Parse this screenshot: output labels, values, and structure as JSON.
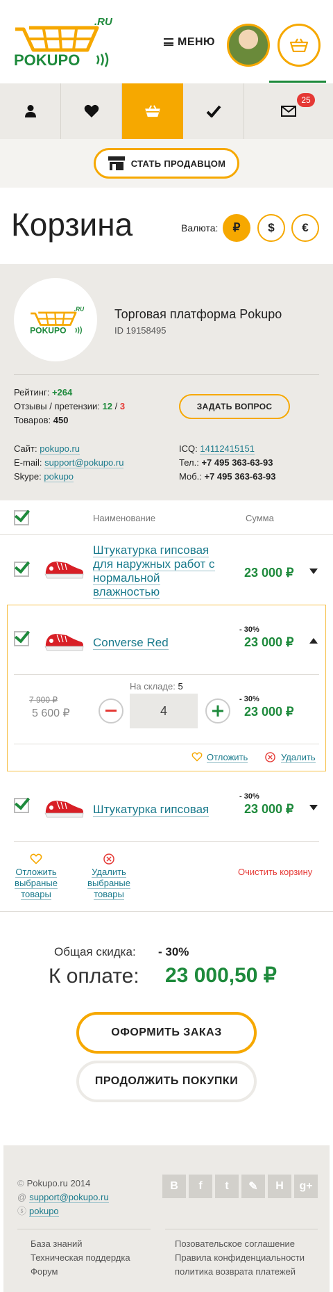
{
  "header": {
    "menu_label": "МЕНЮ",
    "brand": "POKUPO",
    "brand_suffix": ".RU"
  },
  "tabs": [
    {
      "icon": "user-icon"
    },
    {
      "icon": "heart-icon"
    },
    {
      "icon": "basket-icon",
      "active": true
    },
    {
      "icon": "check-icon"
    },
    {
      "icon": "envelope-icon",
      "badge": "25"
    }
  ],
  "seller_button": "СТАТЬ ПРОДАВЦОМ",
  "page": {
    "title": "Корзина",
    "currency_label": "Валюта:",
    "currencies": [
      "₽",
      "$",
      "€"
    ]
  },
  "shop": {
    "name": "Торговая платформа Pokupo",
    "id": "ID 19158495",
    "rating_label": "Рейтинг:",
    "rating_value": "+264",
    "reviews_label": "Отзывы / претензии:",
    "reviews_good": "12",
    "reviews_sep": "/",
    "reviews_bad": "3",
    "goods_label": "Товаров:",
    "goods_value": "450",
    "ask_button": "ЗАДАТЬ ВОПРОС",
    "site_label": "Сайт:",
    "site_value": "pokupo.ru",
    "email_label": "E-mail:",
    "email_value": "support@pokupo.ru",
    "skype_label": "Skype:",
    "skype_value": "pokupo",
    "icq_label": "ICQ:",
    "icq_value": "14112415151",
    "tel_label": "Тел.:",
    "tel_value": "+7 495 363-63-93",
    "mob_label": "Моб.:",
    "mob_value": "+7 495 363-63-93"
  },
  "table": {
    "col_name": "Наименование",
    "col_sum": "Сумма"
  },
  "items": [
    {
      "name": "Штукатурка гипсовая для наружных работ с нормальной влажностью",
      "price": "23 000 ₽",
      "discount": ""
    },
    {
      "name": "Converse Red",
      "price": "23 000 ₽",
      "discount": "- 30%"
    },
    {
      "name": "Штукатурка гипсовая",
      "price": "23 000 ₽",
      "discount": "- 30%"
    }
  ],
  "expanded": {
    "old_price": "7 900 ₽",
    "new_price": "5 600 ₽",
    "stock_label": "На складе:",
    "stock_value": "5",
    "quantity": "4",
    "discount": "- 30%",
    "sum": "23 000 ₽",
    "postpone": "Отложить",
    "delete": "Удалить"
  },
  "bulk": {
    "postpone_line1": "Отложить",
    "postpone_line2": "выбраные",
    "postpone_line3": "товары",
    "delete_line1": "Удалить",
    "delete_line2": "выбраные",
    "delete_line3": "товары",
    "clear": "Очистить корзину"
  },
  "totals": {
    "discount_label": "Общая скидка:",
    "discount_value": "- 30%",
    "pay_label": "К оплате:",
    "pay_value": "23 000,50 ₽"
  },
  "buttons": {
    "checkout": "ОФОРМИТЬ ЗАКАЗ",
    "continue": "ПРОДОЛЖИТЬ ПОКУПКИ"
  },
  "footer": {
    "copyright": "Pokupo.ru 2014",
    "email": "support@pokupo.ru",
    "skype": "pokupo",
    "social": [
      "В",
      "f",
      "t",
      "✎",
      "Н",
      "g+"
    ],
    "links_left": [
      "База знаний",
      "Техническая поддердка",
      "Форум"
    ],
    "links_right": [
      "Позовательское соглашение",
      "Правила конфиденциальности",
      "политика возврата платежей"
    ]
  },
  "colors": {
    "accent": "#f6a800",
    "green": "#1e8a3c",
    "red": "#e53935",
    "link": "#1a7a8c",
    "panel": "#eceae6"
  }
}
